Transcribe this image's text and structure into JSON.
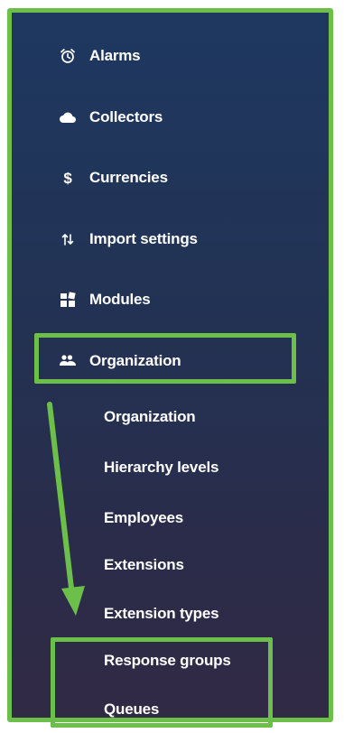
{
  "menu": {
    "items": [
      {
        "label": "Alarms",
        "icon": "alarm-clock-icon"
      },
      {
        "label": "Collectors",
        "icon": "cloud-icon"
      },
      {
        "label": "Currencies",
        "icon": "dollar-icon"
      },
      {
        "label": "Import settings",
        "icon": "import-arrows-icon"
      },
      {
        "label": "Modules",
        "icon": "modules-icon"
      },
      {
        "label": "Organization",
        "icon": "people-icon"
      }
    ],
    "sub_items": [
      "Organization",
      "Hierarchy levels",
      "Employees",
      "Extensions",
      "Extension types",
      "Response groups",
      "Queues"
    ]
  },
  "colors": {
    "highlight": "#6cc04a",
    "sidebar_top": "#1e3860",
    "sidebar_bottom": "#312a45",
    "text": "#ffffff"
  }
}
